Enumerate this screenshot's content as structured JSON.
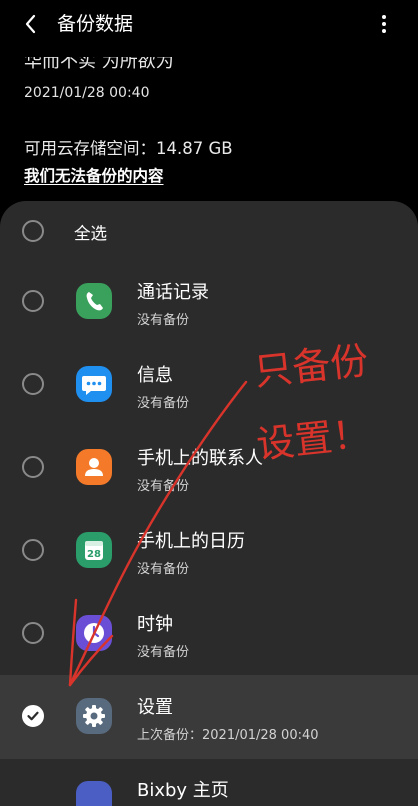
{
  "header": {
    "title": "备份数据"
  },
  "top": {
    "cut_text": "华而不实 为所欲为",
    "date": "2021/01/28 00:40",
    "storage": "可用云存储空间：14.87 GB",
    "cannot_backup_link": "我们无法备份的内容"
  },
  "sheet": {
    "select_all": "全选",
    "items": [
      {
        "name": "通话记录",
        "status": "没有备份",
        "icon": "phone-icon",
        "color": "#3aa15d"
      },
      {
        "name": "信息",
        "status": "没有备份",
        "icon": "message-icon",
        "color": "#1f8ff0"
      },
      {
        "name": "手机上的联系人",
        "status": "没有备份",
        "icon": "contact-icon",
        "color": "#f47a2a"
      },
      {
        "name": "手机上的日历",
        "status": "没有备份",
        "icon": "calendar-icon",
        "color": "#2a9d6a"
      },
      {
        "name": "时钟",
        "status": "没有备份",
        "icon": "clock-icon",
        "color": "#6a4fd6"
      },
      {
        "name": "设置",
        "status": "上次备份：2021/01/28 00:40",
        "icon": "gear-icon",
        "color": "#586a7e",
        "checked": true
      },
      {
        "name": "Bixby 主页",
        "status": "",
        "icon": "bixby-icon",
        "color": "#4a5ec4"
      }
    ],
    "calendar_day": "28"
  },
  "annotation": {
    "line1": "只备份",
    "line2": "设置！",
    "color": "#d9342b"
  }
}
